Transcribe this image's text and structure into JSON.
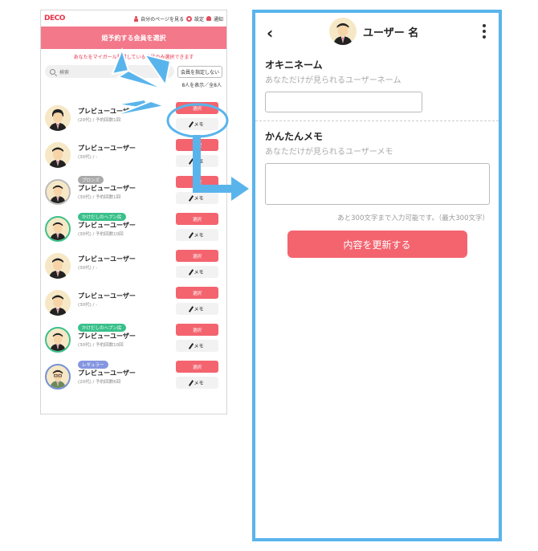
{
  "app": {
    "logo": "DECO",
    "nav": {
      "mypage": "自分のページを見る",
      "settings": "設定",
      "notify": "通知"
    },
    "title": "姫予約する会員を選択",
    "notice": "あなたをマイガール登録している会員のみ選択できます",
    "search": {
      "placeholder": "検索"
    },
    "no_select": "会員を指定しない",
    "count": "8人を表示／全8人",
    "select_label": "選択",
    "memo_label": "メモ",
    "rows": [
      {
        "badge": "",
        "name": "プレビューユーザー",
        "info": "(20代) / 予約回数1回"
      },
      {
        "badge": "",
        "name": "プレビューユーザー",
        "info": "(30代) / -"
      },
      {
        "badge": "ブロンズ",
        "name": "プレビューユーザー",
        "info": "(30代) / 予約回数1回"
      },
      {
        "badge": "かけだしのヘブン民",
        "name": "プレビューユーザー",
        "info": "(30代) / 予約回数10回"
      },
      {
        "badge": "",
        "name": "プレビューユーザー",
        "info": "(30代) / -"
      },
      {
        "badge": "",
        "name": "プレビューユーザー",
        "info": "(30代) / -"
      },
      {
        "badge": "かけだしのヘブン民",
        "name": "プレビューユーザー",
        "info": "(30代) / 予約回数10回"
      },
      {
        "badge": "レギュラー",
        "name": "プレビューユーザー",
        "info": "(20代) / 予約回数6回"
      }
    ]
  },
  "panel": {
    "title": "ユーザー 名",
    "nickname": {
      "label": "オキニネーム",
      "sub": "あなただけが見られるユーザーネーム",
      "value": ""
    },
    "memo": {
      "label": "かんたんメモ",
      "sub": "あなただけが見られるユーザーメモ",
      "value": ""
    },
    "hint": "あと300文字まで入力可能です。（最大300文字）",
    "update_label": "内容を更新する"
  },
  "colors": {
    "accent": "#f3646f",
    "header_pink": "#f3788a",
    "frame_blue": "#5ab4ec",
    "badge_green": "#3ac08a",
    "badge_blue": "#8596e0",
    "badge_gray": "#aaaaaa"
  }
}
